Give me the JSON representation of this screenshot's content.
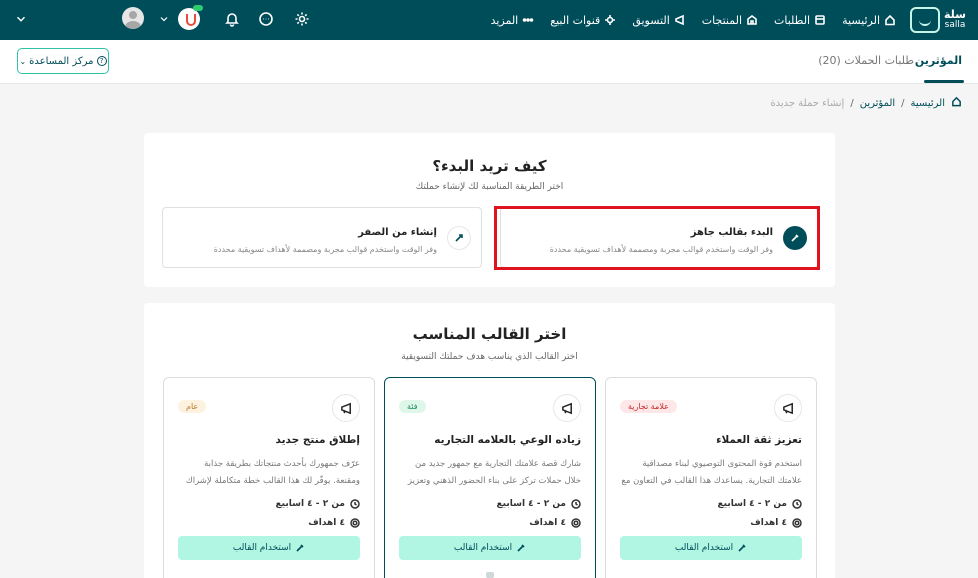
{
  "brand": {
    "name_ar": "سلة",
    "name_en": "salla"
  },
  "nav": [
    {
      "label": "الرئيسية",
      "icon": "home-icon"
    },
    {
      "label": "الطلبات",
      "icon": "orders-icon"
    },
    {
      "label": "المنتجات",
      "icon": "products-icon"
    },
    {
      "label": "التسويق",
      "icon": "megaphone-icon"
    },
    {
      "label": "قنوات البيع",
      "icon": "channels-icon"
    },
    {
      "label": "المزيد",
      "icon": "more-dots-icon"
    }
  ],
  "tabs": {
    "active": "المؤثرين",
    "other": "طلبات الحملات (20)"
  },
  "help_button": "مركز المساعدة",
  "breadcrumb": {
    "home": "الرئيسية",
    "section": "المؤثرين",
    "current": "إنشاء حملة جديدة"
  },
  "start": {
    "title": "كيف تريد البدء؟",
    "subtitle": "اختر الطريقة المناسبة لك لإنشاء حملتك",
    "options": [
      {
        "title": "البدء بقالب جاهز",
        "desc": "وفر الوقت واستخدم قوالب مجربة ومصممة لأهداف تسويقية محددة"
      },
      {
        "title": "إنشاء من الصفر",
        "desc": "وفر الوقت واستخدم قوالب مجربة ومصممة لأهداف تسويقية محددة"
      }
    ]
  },
  "templates": {
    "title": "اختر القالب المناسب",
    "subtitle": "اختر القالب الذي يناسب هدف حملتك التسويقية",
    "items": [
      {
        "badge": "علامة تجارية",
        "title": "تعزيز ثقة العملاء",
        "desc": "استخدم قوة المحتوى التوصيوي لبناء مصداقية علامتك التجارية. يساعدك هذا القالب في التعاون مع",
        "duration": "من ٢ - ٤ اسابيع",
        "goals": "٤ اهداف",
        "button": "استخدام القالب",
        "badge_color": "#c62828",
        "badge_bg": "#fde7e7"
      },
      {
        "badge": "فئة",
        "title": "زياده الوعي بالعلامه التجاريه",
        "desc": "شارك قصة علامتك التجارية مع جمهور جديد من خلال حملات تركز على بناء الحضور الذهني وتعزيز",
        "duration": "من ٢ - ٤ اسابيع",
        "goals": "٤ اهداف",
        "button": "استخدام القالب",
        "badge_color": "#1e8e5a",
        "badge_bg": "#dff6ea"
      },
      {
        "badge": "عام",
        "title": "إطلاق منتج جديد",
        "desc": "عرّف جمهورك بأحدث منتجاتك بطريقة جذابة ومقنعة. يوفّر لك هذا القالب خطة متكاملة لإشراك",
        "duration": "من ٢ - ٤ اسابيع",
        "goals": "٤ اهداف",
        "button": "استخدام القالب",
        "badge_color": "#b7791f",
        "badge_bg": "#fdf1e0"
      }
    ]
  },
  "colors": {
    "primary": "#004d5a",
    "accent": "#b1f6e3",
    "highlight": "#e0141e"
  }
}
